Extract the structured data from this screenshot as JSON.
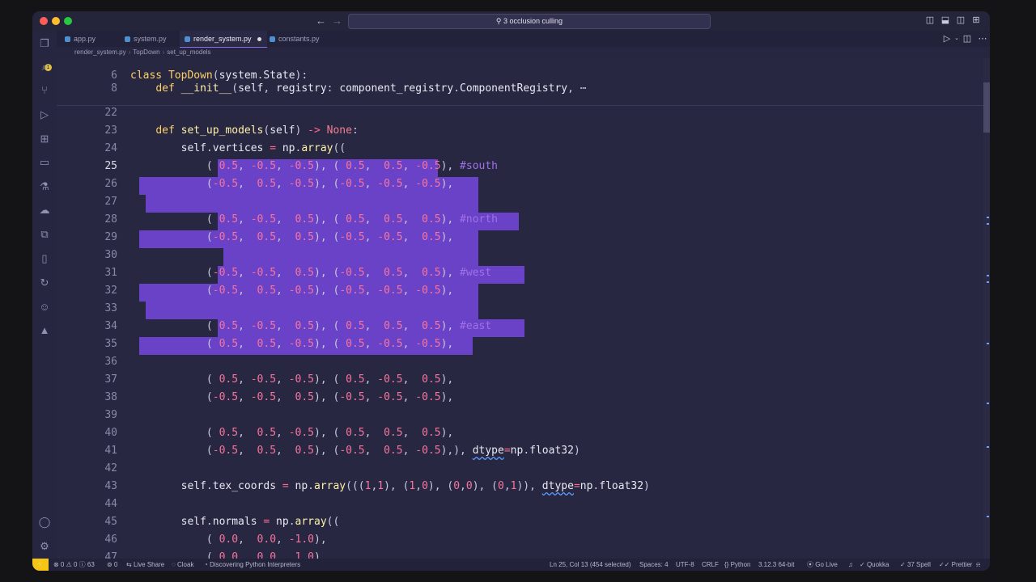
{
  "window": {
    "command_center": "⚲ 3 occlusion culling"
  },
  "activity_bar": {
    "icons": [
      "files-icon",
      "search-icon",
      "source-control-icon",
      "run-debug-icon",
      "extensions-icon",
      "remote-explorer-icon",
      "testing-icon",
      "docker-icon",
      "pages-icon",
      "bookmark-icon",
      "live-share-icon",
      "copilot-icon",
      "azure-icon",
      "account-icon",
      "settings-gear-icon"
    ],
    "explorer_badge": "1"
  },
  "tabs": [
    {
      "label": "app.py"
    },
    {
      "label": "system.py"
    },
    {
      "label": "render_system.py",
      "modified": true
    },
    {
      "label": "constants.py"
    }
  ],
  "breadcrumb": [
    "render_system.py",
    "TopDown",
    "set_up_models"
  ],
  "editor": {
    "cursor_line": "25",
    "lines": [
      {
        "n": "6",
        "html": "<span class='kw'>class</span> <span class='cls'>TopDown</span><span class='punc'>(</span>system<span class='punc'>.</span>State<span class='punc'>):</span>"
      },
      {
        "n": "8",
        "html": "    <span class='kw'>def</span> <span class='fn'>__init__</span><span class='punc'>(</span>self<span class='punc'>,</span> registry<span class='punc'>:</span> component_registry<span class='punc'>.</span>ComponentRegistry<span class='punc'>,</span> <span class='punc'>⋯</span>"
      },
      {
        "n": "22",
        "html": ""
      },
      {
        "n": "23",
        "html": "    <span class='kw'>def</span> <span class='fn'>set_up_models</span><span class='punc'>(</span>self<span class='punc'>)</span> <span class='op'>-&gt;</span> <span class='none'>None</span><span class='punc'>:</span>"
      },
      {
        "n": "24",
        "html": "        self<span class='punc'>.</span>vertices <span class='op'>=</span> np<span class='punc'>.</span><span class='fn'>array</span><span class='punc'>((</span>"
      },
      {
        "n": "25",
        "html": "            <span class='punc'>(</span> <span class='num'>0.5</span><span class='punc'>,</span> <span class='op'>-</span><span class='num'>0.5</span><span class='punc'>,</span> <span class='op'>-</span><span class='num'>0.5</span><span class='punc'>),</span> <span class='punc'>(</span> <span class='num'>0.5</span><span class='punc'>,</span>  <span class='num'>0.5</span><span class='punc'>,</span> <span class='op'>-</span><span class='num'>0.5</span><span class='punc'>),</span> <span class='cmt'>#south</span>"
      },
      {
        "n": "26",
        "html": "            <span class='punc'>(</span><span class='op'>-</span><span class='num'>0.5</span><span class='punc'>,</span>  <span class='num'>0.5</span><span class='punc'>,</span> <span class='op'>-</span><span class='num'>0.5</span><span class='punc'>),</span> <span class='punc'>(</span><span class='op'>-</span><span class='num'>0.5</span><span class='punc'>,</span> <span class='op'>-</span><span class='num'>0.5</span><span class='punc'>,</span> <span class='op'>-</span><span class='num'>0.5</span><span class='punc'>),</span>"
      },
      {
        "n": "27",
        "html": ""
      },
      {
        "n": "28",
        "html": "            <span class='punc'>(</span> <span class='num'>0.5</span><span class='punc'>,</span> <span class='op'>-</span><span class='num'>0.5</span><span class='punc'>,</span>  <span class='num'>0.5</span><span class='punc'>),</span> <span class='punc'>(</span> <span class='num'>0.5</span><span class='punc'>,</span>  <span class='num'>0.5</span><span class='punc'>,</span>  <span class='num'>0.5</span><span class='punc'>),</span> <span class='cmt'>#north</span>"
      },
      {
        "n": "29",
        "html": "            <span class='punc'>(</span><span class='op'>-</span><span class='num'>0.5</span><span class='punc'>,</span>  <span class='num'>0.5</span><span class='punc'>,</span>  <span class='num'>0.5</span><span class='punc'>),</span> <span class='punc'>(</span><span class='op'>-</span><span class='num'>0.5</span><span class='punc'>,</span> <span class='op'>-</span><span class='num'>0.5</span><span class='punc'>,</span>  <span class='num'>0.5</span><span class='punc'>),</span>"
      },
      {
        "n": "30",
        "html": ""
      },
      {
        "n": "31",
        "html": "            <span class='punc'>(</span><span class='op'>-</span><span class='num'>0.5</span><span class='punc'>,</span> <span class='op'>-</span><span class='num'>0.5</span><span class='punc'>,</span>  <span class='num'>0.5</span><span class='punc'>),</span> <span class='punc'>(</span><span class='op'>-</span><span class='num'>0.5</span><span class='punc'>,</span>  <span class='num'>0.5</span><span class='punc'>,</span>  <span class='num'>0.5</span><span class='punc'>),</span> <span class='cmt'>#west</span>"
      },
      {
        "n": "32",
        "html": "            <span class='punc'>(</span><span class='op'>-</span><span class='num'>0.5</span><span class='punc'>,</span>  <span class='num'>0.5</span><span class='punc'>,</span> <span class='op'>-</span><span class='num'>0.5</span><span class='punc'>),</span> <span class='punc'>(</span><span class='op'>-</span><span class='num'>0.5</span><span class='punc'>,</span> <span class='op'>-</span><span class='num'>0.5</span><span class='punc'>,</span> <span class='op'>-</span><span class='num'>0.5</span><span class='punc'>),</span>"
      },
      {
        "n": "33",
        "html": ""
      },
      {
        "n": "34",
        "html": "            <span class='punc'>(</span> <span class='num'>0.5</span><span class='punc'>,</span> <span class='op'>-</span><span class='num'>0.5</span><span class='punc'>,</span>  <span class='num'>0.5</span><span class='punc'>),</span> <span class='punc'>(</span> <span class='num'>0.5</span><span class='punc'>,</span>  <span class='num'>0.5</span><span class='punc'>,</span>  <span class='num'>0.5</span><span class='punc'>),</span> <span class='cmt'>#east</span>"
      },
      {
        "n": "35",
        "html": "            <span class='punc'>(</span> <span class='num'>0.5</span><span class='punc'>,</span>  <span class='num'>0.5</span><span class='punc'>,</span> <span class='op'>-</span><span class='num'>0.5</span><span class='punc'>),</span> <span class='punc'>(</span> <span class='num'>0.5</span><span class='punc'>,</span> <span class='op'>-</span><span class='num'>0.5</span><span class='punc'>,</span> <span class='op'>-</span><span class='num'>0.5</span><span class='punc'>),</span>"
      },
      {
        "n": "36",
        "html": ""
      },
      {
        "n": "37",
        "html": "            <span class='punc'>(</span> <span class='num'>0.5</span><span class='punc'>,</span> <span class='op'>-</span><span class='num'>0.5</span><span class='punc'>,</span> <span class='op'>-</span><span class='num'>0.5</span><span class='punc'>),</span> <span class='punc'>(</span> <span class='num'>0.5</span><span class='punc'>,</span> <span class='op'>-</span><span class='num'>0.5</span><span class='punc'>,</span>  <span class='num'>0.5</span><span class='punc'>),</span>"
      },
      {
        "n": "38",
        "html": "            <span class='punc'>(</span><span class='op'>-</span><span class='num'>0.5</span><span class='punc'>,</span> <span class='op'>-</span><span class='num'>0.5</span><span class='punc'>,</span>  <span class='num'>0.5</span><span class='punc'>),</span> <span class='punc'>(</span><span class='op'>-</span><span class='num'>0.5</span><span class='punc'>,</span> <span class='op'>-</span><span class='num'>0.5</span><span class='punc'>,</span> <span class='op'>-</span><span class='num'>0.5</span><span class='punc'>),</span>"
      },
      {
        "n": "39",
        "html": ""
      },
      {
        "n": "40",
        "html": "            <span class='punc'>(</span> <span class='num'>0.5</span><span class='punc'>,</span>  <span class='num'>0.5</span><span class='punc'>,</span> <span class='op'>-</span><span class='num'>0.5</span><span class='punc'>),</span> <span class='punc'>(</span> <span class='num'>0.5</span><span class='punc'>,</span>  <span class='num'>0.5</span><span class='punc'>,</span>  <span class='num'>0.5</span><span class='punc'>),</span>"
      },
      {
        "n": "41",
        "html": "            <span class='punc'>(</span><span class='op'>-</span><span class='num'>0.5</span><span class='punc'>,</span>  <span class='num'>0.5</span><span class='punc'>,</span>  <span class='num'>0.5</span><span class='punc'>),</span> <span class='punc'>(</span><span class='op'>-</span><span class='num'>0.5</span><span class='punc'>,</span>  <span class='num'>0.5</span><span class='punc'>,</span> <span class='op'>-</span><span class='num'>0.5</span><span class='punc'>),),</span> <span class='sq'>dtype</span><span class='op'>=</span>np<span class='punc'>.</span>float32<span class='punc'>)</span>"
      },
      {
        "n": "42",
        "html": ""
      },
      {
        "n": "43",
        "html": "        self<span class='punc'>.</span>tex_coords <span class='op'>=</span> np<span class='punc'>.</span><span class='fn'>array</span><span class='punc'>(((</span><span class='num'>1</span><span class='punc'>,</span><span class='num'>1</span><span class='punc'>),</span> <span class='punc'>(</span><span class='num'>1</span><span class='punc'>,</span><span class='num'>0</span><span class='punc'>),</span> <span class='punc'>(</span><span class='num'>0</span><span class='punc'>,</span><span class='num'>0</span><span class='punc'>),</span> <span class='punc'>(</span><span class='num'>0</span><span class='punc'>,</span><span class='num'>1</span><span class='punc'>)),</span> <span class='sq'>dtype</span><span class='op'>=</span>np<span class='punc'>.</span>float32<span class='punc'>)</span>"
      },
      {
        "n": "44",
        "html": ""
      },
      {
        "n": "45",
        "html": "        self<span class='punc'>.</span>normals <span class='op'>=</span> np<span class='punc'>.</span><span class='fn'>array</span><span class='punc'>((</span>"
      },
      {
        "n": "46",
        "html": "            <span class='punc'>(</span> <span class='num'>0.0</span><span class='punc'>,</span>  <span class='num'>0.0</span><span class='punc'>,</span> <span class='op'>-</span><span class='num'>1.0</span><span class='punc'>),</span>"
      },
      {
        "n": "47",
        "html": "            <span class='punc'>(</span> <span class='num'>0.0</span><span class='punc'>,</span>  <span class='num'>0.0</span><span class='punc'>,</span>  <span class='num'>1.0</span><span class='punc'>),</span>"
      }
    ]
  },
  "statusbar": {
    "remote": "⚡",
    "problems": "⊗ 0 ⚠ 0 ⓘ 63",
    "ports": "⊚ 0",
    "live_share": "Live Share",
    "cloak": "Cloak",
    "discovering": "Discovering Python Interpreters",
    "position": "Ln 25, Col 13 (454 selected)",
    "spaces": "Spaces: 4",
    "encoding": "UTF-8",
    "eol": "CRLF",
    "language": "Python",
    "interpreter": "3.12.3 64-bit",
    "go_live": "Go Live",
    "quokka": "Quokka",
    "spell": "37 Spell",
    "prettier": "Prettier"
  },
  "colors": {
    "editor_bg": "#272742",
    "selection": "#6a42c8",
    "keyword": "#ffd166",
    "number": "#f7749c",
    "remote_badge": "#f5c518"
  }
}
